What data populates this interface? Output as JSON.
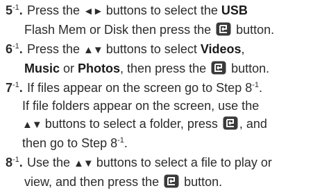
{
  "steps": [
    {
      "number": "5",
      "sup": "-1",
      "lines": [
        {
          "parts": [
            "Press the ",
            "◄►",
            " buttons to select the ",
            "USB"
          ]
        },
        {
          "parts": [
            "Flash Mem or Disk then press the ",
            "",
            " button."
          ]
        }
      ]
    },
    {
      "number": "6",
      "sup": "-1",
      "lines": [
        {
          "parts": [
            "Press the ",
            "▲▼",
            " buttons to select ",
            "Videos",
            ","
          ]
        },
        {
          "parts": [
            "Music",
            " or ",
            "Photos",
            ", then press the ",
            "",
            " button."
          ]
        }
      ]
    },
    {
      "number": "7",
      "sup": "-1",
      "lines": [
        {
          "parts": [
            "If files appear on the screen go to Step 8",
            "-1",
            "."
          ]
        },
        {
          "parts": [
            "If file folders appear on the screen, use the"
          ]
        },
        {
          "parts": [
            "▲▼",
            " buttons to select a folder, press ",
            "",
            ", and"
          ]
        },
        {
          "parts": [
            "then go to Step 8",
            "-1",
            "."
          ]
        }
      ]
    },
    {
      "number": "8",
      "sup": "-1",
      "lines": [
        {
          "parts": [
            "Use the ",
            "▲▼",
            " buttons to select a file to play or"
          ]
        },
        {
          "parts": [
            "view, and then press the ",
            "",
            " button."
          ]
        }
      ]
    }
  ],
  "icons": {
    "enter_button": "enter-icon",
    "left_right_arrows": "◄►",
    "up_down_arrows": "▲▼"
  },
  "colors": {
    "text": "#2b2b2b",
    "enter_icon_bg": "#3a3a3a",
    "enter_icon_fg": "#ffffff"
  }
}
